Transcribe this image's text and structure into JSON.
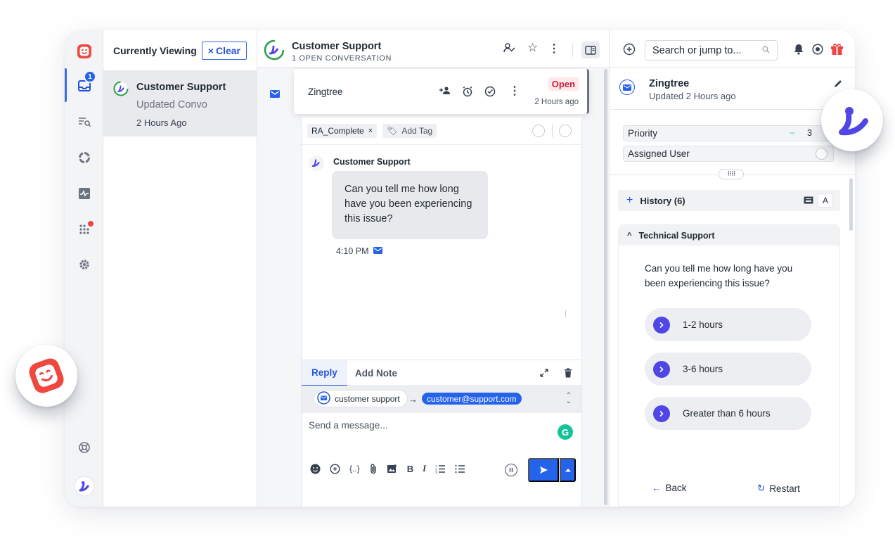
{
  "list": {
    "heading": "Currently Viewing",
    "clear_label": "Clear",
    "conversation": {
      "name": "Customer Support",
      "subtitle": "Updated Convo",
      "time": "2 Hours Ago"
    }
  },
  "rail": {
    "inbox_badge": "1"
  },
  "header": {
    "title": "Customer Support",
    "count": "1 OPEN CONVERSATION"
  },
  "card": {
    "name": "Zingtree",
    "status": "Open",
    "ago": "2 Hours ago"
  },
  "tags": {
    "items": [
      "RA_Complete"
    ],
    "add_label": "Add Tag"
  },
  "message": {
    "sender": "Customer Support",
    "text": "Can you tell me how long have you been experiencing this issue?",
    "time": "4:10 PM"
  },
  "reply": {
    "tab_reply": "Reply",
    "tab_note": "Add Note",
    "from": "customer support",
    "to": "customer@support.com",
    "placeholder": "Send a message..."
  },
  "right": {
    "search_placeholder": "Search or jump to...",
    "contact_name": "Zingtree",
    "contact_updated": "Updated 2 Hours ago",
    "priority_label": "Priority",
    "priority_value": "3",
    "assigned_label": "Assigned User",
    "history_label": "History (6)",
    "history_a": "A",
    "section_title": "Technical Support",
    "question": "Can you tell me how long have you been experiencing this issue?",
    "choices": [
      "1-2 hours",
      "3-6 hours",
      "Greater than 6 hours"
    ],
    "back_label": "Back",
    "restart_label": "Restart"
  },
  "colors": {
    "accent": "#2563eb",
    "choice": "#4f46e5",
    "danger": "#ef4444",
    "brand_red": "#f0483e"
  }
}
